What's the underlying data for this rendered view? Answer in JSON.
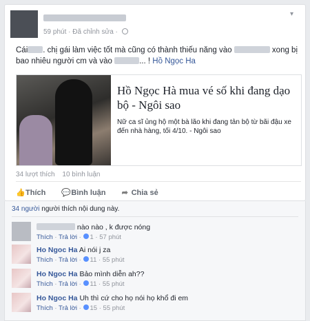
{
  "post": {
    "time": "59 phút",
    "edited": "Đã chỉnh sửa",
    "text_1": "Cái",
    "text_2": ". chị gái làm việc tốt mà cũng có thành thiếu năng vào",
    "text_3": "xong bị bao nhiêu người cm và vào",
    "text_4": "... !",
    "mention": "Hồ Ngọc Ha"
  },
  "share": {
    "title": "Hồ Ngọc Hà mua vé số khi đang dạo bộ - Ngôi sao",
    "desc": "Nữ ca sĩ ủng hộ một bà lão khi đang tản bộ từ bãi đậu xe đến nhà hàng, tối 4/10. - Ngôi sao"
  },
  "stats": {
    "likes": "34 lượt thích",
    "comments": "10 bình luận"
  },
  "actions": {
    "like": "Thích",
    "comment": "Bình luận",
    "share": "Chia sẻ"
  },
  "likers": {
    "count": "34 người",
    "text": "người thích nội dung này."
  },
  "comments": [
    {
      "author": "",
      "text": "nào nào , k được nóng",
      "like": "Thích",
      "reply": "Trả lời",
      "likes": "1",
      "time": "57 phút"
    },
    {
      "author": "Ho Ngoc Ha",
      "text": "Ai nói j za",
      "like": "Thích",
      "reply": "Trả lời",
      "likes": "11",
      "time": "55 phút"
    },
    {
      "author": "Ho Ngoc Ha",
      "text": "Bảo mình diễn ah??",
      "like": "Thích",
      "reply": "Trả lời",
      "likes": "11",
      "time": "55 phút"
    },
    {
      "author": "Ho Ngoc Ha",
      "text": "Uh thì cứ cho họ nói họ khổ đi em",
      "like": "Thích",
      "reply": "Trả lời",
      "likes": "15",
      "time": "55 phút"
    }
  ]
}
